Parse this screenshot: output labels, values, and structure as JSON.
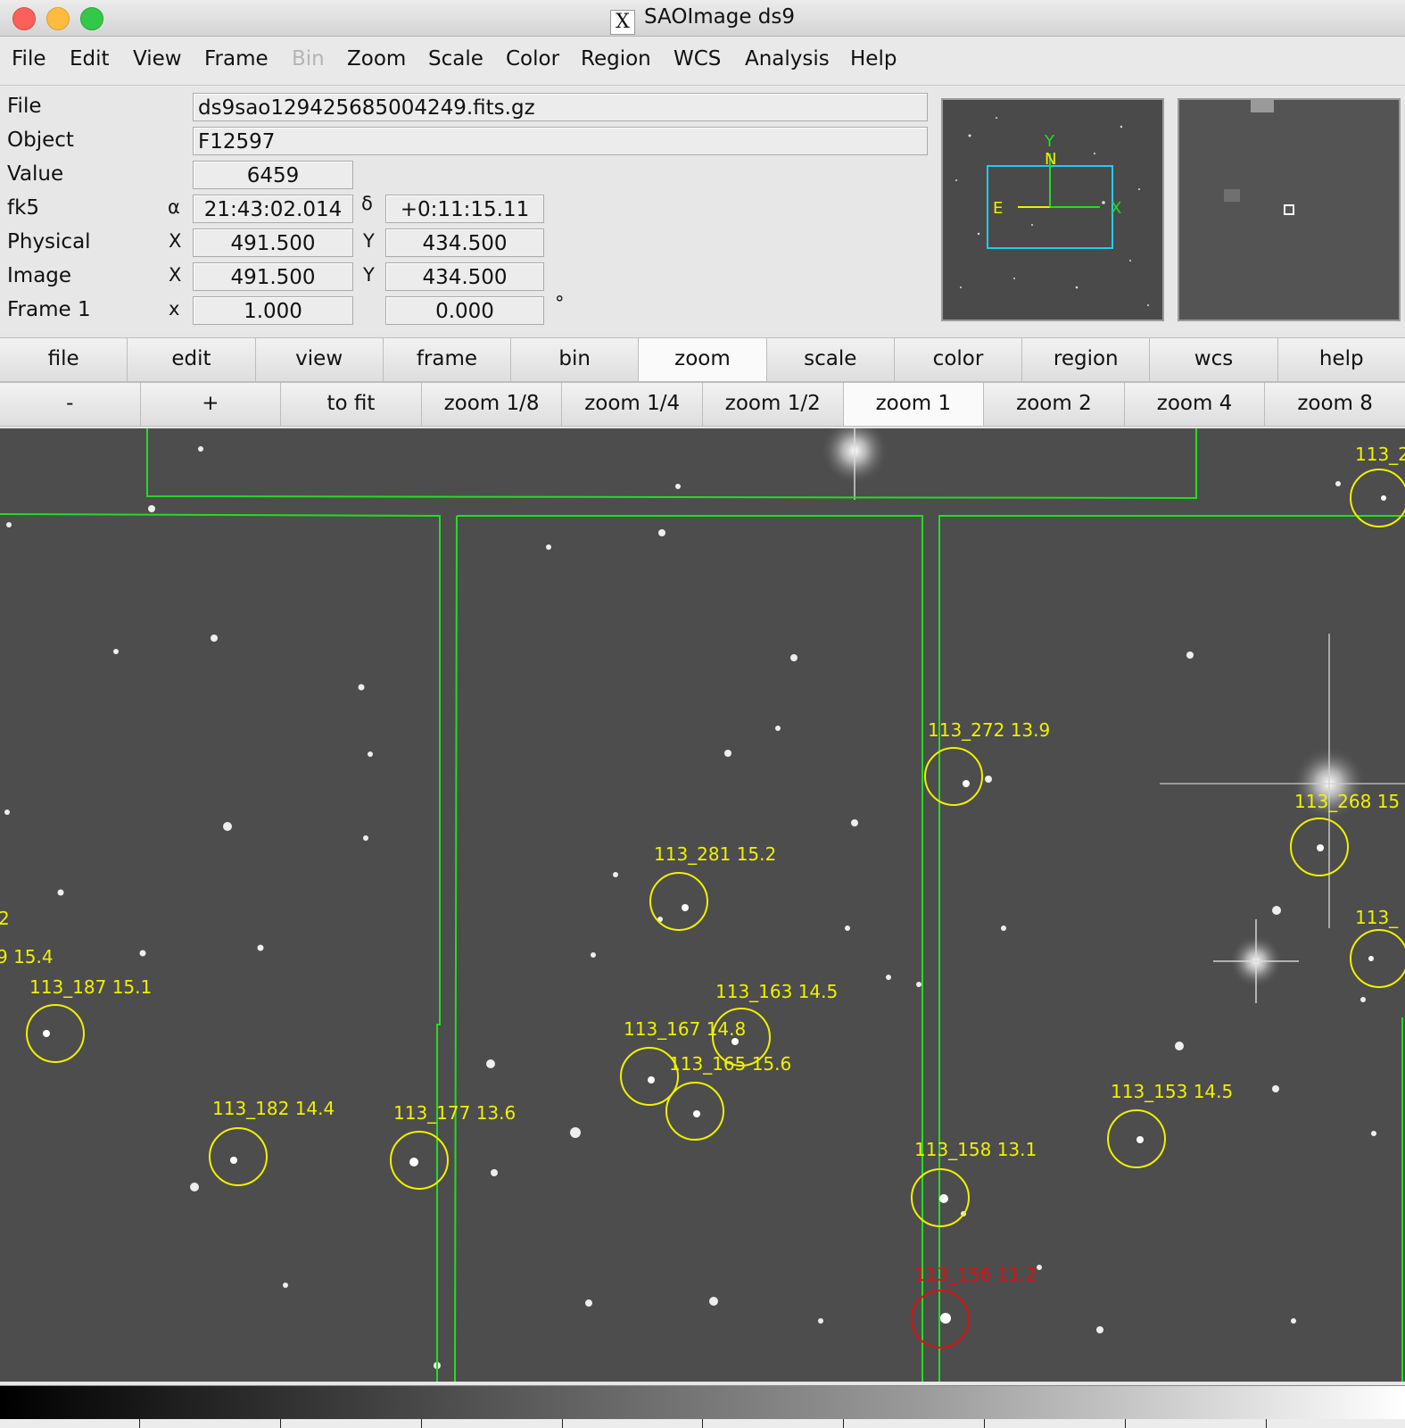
{
  "window": {
    "title": "SAOImage ds9",
    "icon": "x11-icon"
  },
  "menubar": {
    "items": [
      "File",
      "Edit",
      "View",
      "Frame",
      "Bin",
      "Zoom",
      "Scale",
      "Color",
      "Region",
      "WCS",
      "Analysis",
      "Help"
    ],
    "disabled": [
      "Bin"
    ]
  },
  "info": {
    "file_label": "File",
    "file_value": "ds9sao129425685004249.fits.gz",
    "object_label": "Object",
    "object_value": "F12597",
    "value_label": "Value",
    "value_value": "6459",
    "fk5_label": "fk5",
    "fk5_alpha_symbol": "α",
    "fk5_alpha": "21:43:02.014",
    "fk5_delta_symbol": "δ",
    "fk5_delta": "+0:11:15.11",
    "physical_label": "Physical",
    "physical_x_label": "X",
    "physical_x": "491.500",
    "physical_y_label": "Y",
    "physical_y": "434.500",
    "image_label": "Image",
    "image_x_label": "X",
    "image_x": "491.500",
    "image_y_label": "Y",
    "image_y": "434.500",
    "frame_label": "Frame 1",
    "frame_x_label": "x",
    "frame_zoom": "1.000",
    "frame_angle": "0.000",
    "degree_symbol": "°"
  },
  "panner": {
    "n": "N",
    "e": "E",
    "x": "X",
    "y": "Y"
  },
  "buttonbar": {
    "main": [
      "file",
      "edit",
      "view",
      "frame",
      "bin",
      "zoom",
      "scale",
      "color",
      "region",
      "wcs",
      "help"
    ],
    "active_main": "zoom",
    "zoom": [
      "-",
      "+",
      "to fit",
      "zoom 1/8",
      "zoom 1/4",
      "zoom 1/2",
      "zoom 1",
      "zoom 2",
      "zoom 4",
      "zoom 8"
    ],
    "active_zoom": "zoom 1"
  },
  "regions": [
    {
      "label": "113_272 13.9",
      "color": "yellow"
    },
    {
      "label": "113_281 15.2",
      "color": "yellow"
    },
    {
      "label": "113_268 15",
      "color": "yellow"
    },
    {
      "label": "113_187 15.1",
      "color": "yellow"
    },
    {
      "label": "113_163 14.5",
      "color": "yellow"
    },
    {
      "label": "113_167 14.8",
      "color": "yellow"
    },
    {
      "label": "113_165 15.6",
      "color": "yellow"
    },
    {
      "label": "113_182 14.4",
      "color": "yellow"
    },
    {
      "label": "113_177 13.6",
      "color": "yellow"
    },
    {
      "label": "113_153 14.5",
      "color": "yellow"
    },
    {
      "label": "113_158 13.1",
      "color": "yellow"
    },
    {
      "label": "113_156 11.2",
      "color": "red"
    },
    {
      "label": "113_2",
      "color": "yellow"
    },
    {
      "label": "113_",
      "color": "yellow"
    },
    {
      "label": "9 15.4",
      "color": "yellow"
    },
    {
      "label": "2",
      "color": "yellow"
    }
  ],
  "colors": {
    "region_yellow": "#f0f000",
    "region_red": "#e01010",
    "chip_green": "#22dd22",
    "image_bg": "#4d4d4d"
  }
}
